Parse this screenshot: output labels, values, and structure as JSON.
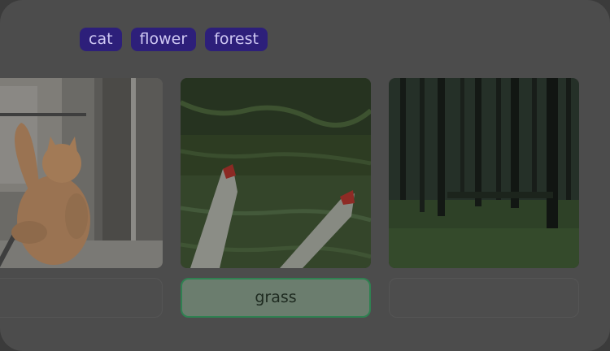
{
  "tags": [
    "cat",
    "flower",
    "forest"
  ],
  "cards": [
    {
      "image": "cat-on-balcony-photo",
      "answer": ""
    },
    {
      "image": "legs-in-grass-photo",
      "answer": "grass"
    },
    {
      "image": "dark-forest-photo",
      "answer": ""
    }
  ],
  "colors": {
    "tag_bg": "#2d1f7a",
    "tag_text": "#cfc8f3",
    "answer_border": "#2f8151",
    "overlay": "#4c4c4c"
  }
}
